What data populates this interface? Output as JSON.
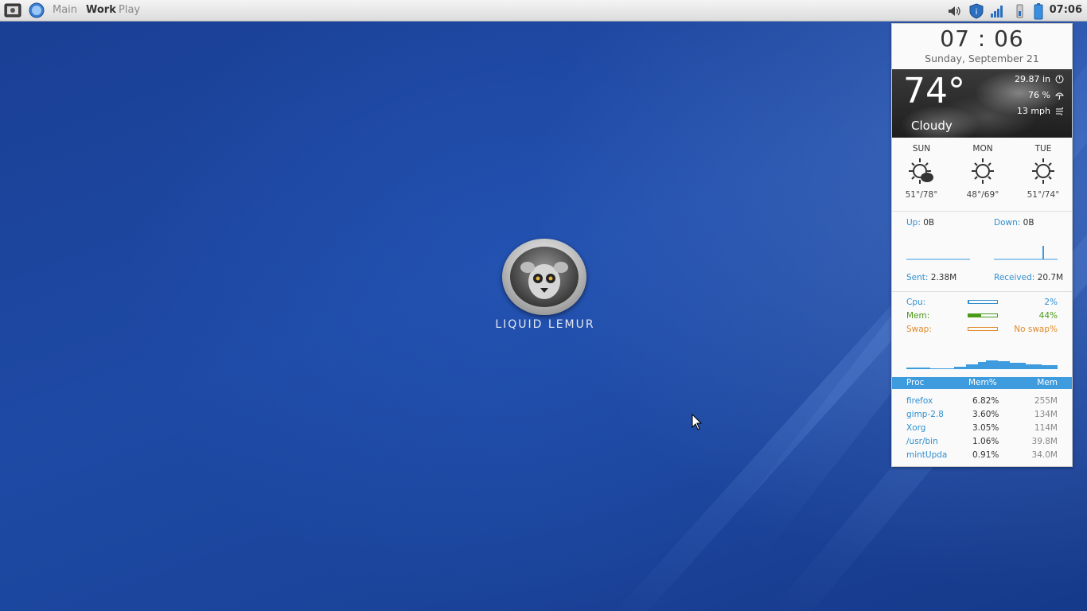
{
  "panel": {
    "workspaces": [
      "Main",
      "Work",
      "Play"
    ],
    "active_workspace": "Work",
    "clock": "07:06",
    "tray_icons": [
      "volume-icon",
      "shield-icon",
      "network-signal-icon",
      "usb-device-icon",
      "battery-icon"
    ]
  },
  "desktop": {
    "logo_text": "LIQUID LEMUR"
  },
  "widget": {
    "time": "07 : 06",
    "date": "Sunday, September 21",
    "weather": {
      "temperature": "74°",
      "condition": "Cloudy",
      "pressure": "29.87 in",
      "humidity": "76 %",
      "wind": "13 mph"
    },
    "forecast": [
      {
        "day": "SUN",
        "temps": "51°/78°",
        "icon": "sun-cloud-icon"
      },
      {
        "day": "MON",
        "temps": "48°/69°",
        "icon": "sun-icon"
      },
      {
        "day": "TUE",
        "temps": "51°/74°",
        "icon": "sun-icon"
      }
    ],
    "network": {
      "up_label": "Up:",
      "up_value": "0B",
      "down_label": "Down:",
      "down_value": "0B",
      "sent_label": "Sent:",
      "sent_value": "2.38M",
      "received_label": "Received:",
      "received_value": "20.7M"
    },
    "system": {
      "cpu_label": "Cpu:",
      "cpu_value": "2%",
      "cpu_fraction": 0.02,
      "mem_label": "Mem:",
      "mem_value": "44%",
      "mem_fraction": 0.44,
      "swap_label": "Swap:",
      "swap_value": "No swap%",
      "swap_fraction": 0
    },
    "colors": {
      "accent": "#2f8fd0",
      "cpu": "#2f8fd0",
      "mem": "#4c9a1a",
      "swap": "#e08a2a"
    },
    "processes": {
      "headers": [
        "Proc",
        "Mem%",
        "Mem"
      ],
      "rows": [
        [
          "firefox",
          "6.82%",
          "255M"
        ],
        [
          "gimp-2.8",
          "3.60%",
          "134M"
        ],
        [
          "Xorg",
          "3.05%",
          "114M"
        ],
        [
          "/usr/bin",
          "1.06%",
          "39.8M"
        ],
        [
          "mintUpda",
          "0.91%",
          "34.0M"
        ]
      ]
    }
  }
}
